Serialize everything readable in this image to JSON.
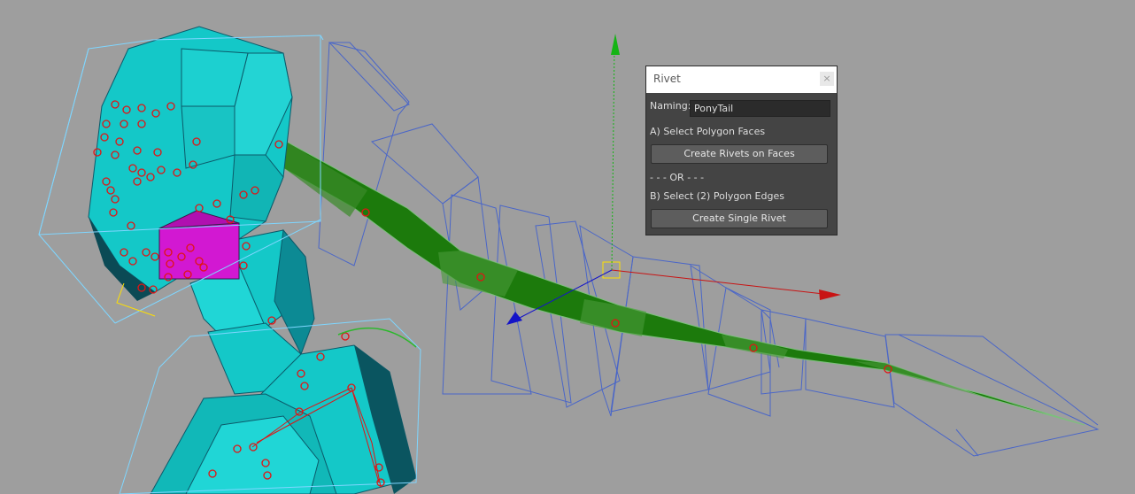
{
  "window": {
    "title": "Rivet",
    "close_glyph": "×"
  },
  "form": {
    "naming_label": "Naming:",
    "naming_value": "PonyTail",
    "step_a_label": "A) Select Polygon Faces",
    "create_faces_button": "Create Rivets on Faces",
    "or_separator": "- - - OR - - -",
    "step_b_label": "B) Select (2) Polygon Edges",
    "create_single_button": "Create Single Rivet"
  },
  "colors": {
    "viewport_background": "#9e9e9e",
    "mesh_cyan": "#14c8c8",
    "selected_face_magenta": "#d218d2",
    "ponytail_green": "#1c7a0c",
    "wireframe_blue": "#4a66c8",
    "locator_red": "#e01414",
    "axis_x": "#c81414",
    "axis_y": "#14b414",
    "axis_z": "#1414c8"
  }
}
